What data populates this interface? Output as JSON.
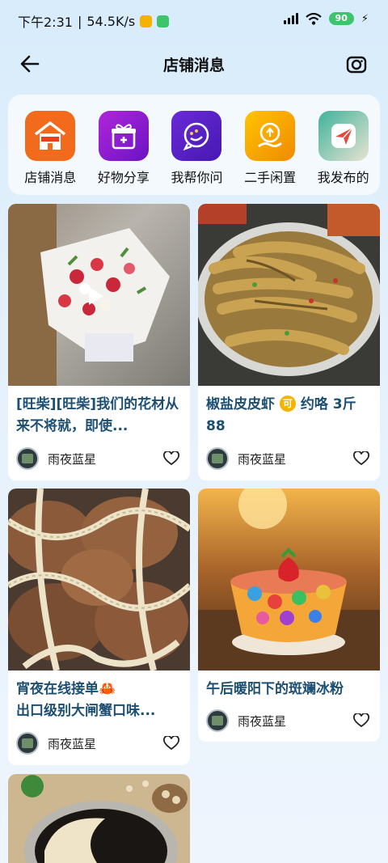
{
  "status_bar": {
    "time": "下午2:31",
    "net_speed": "54.5K/s",
    "battery": "90"
  },
  "header": {
    "title": "店铺消息"
  },
  "shortcuts": [
    {
      "label": "店铺消息",
      "icon": "shop-news-icon",
      "color": "#f26a1b"
    },
    {
      "label": "好物分享",
      "icon": "gift-icon",
      "color": "#8b1fd6"
    },
    {
      "label": "我帮你问",
      "icon": "chat-icon",
      "color": "#5a24c9"
    },
    {
      "label": "二手闲置",
      "icon": "recycle-hand-icon",
      "color": "#f5b400"
    },
    {
      "label": "我发布的",
      "icon": "paper-plane-icon",
      "color": "#e5483d"
    }
  ],
  "feed": [
    {
      "title": "[旺柴][旺柴]我们的花材从来不将就，即使...",
      "author": "雨夜蓝星",
      "image": "flower-bouquet-image",
      "video": true
    },
    {
      "title": "椒盐皮皮虾",
      "title_suffix": "约咯 3斤88",
      "badge": "可",
      "author": "雨夜蓝星",
      "image": "mantis-shrimp-image"
    },
    {
      "title": "宵夜在线接单🦀",
      "title_line2": "出口级别大闸蟹口味...",
      "author": "雨夜蓝星",
      "image": "hairy-crab-image"
    },
    {
      "title": "午后暖阳下的斑斓冰粉",
      "author": "雨夜蓝星",
      "image": "ice-jelly-dessert-image"
    },
    {
      "image": "sesame-paste-image"
    }
  ]
}
